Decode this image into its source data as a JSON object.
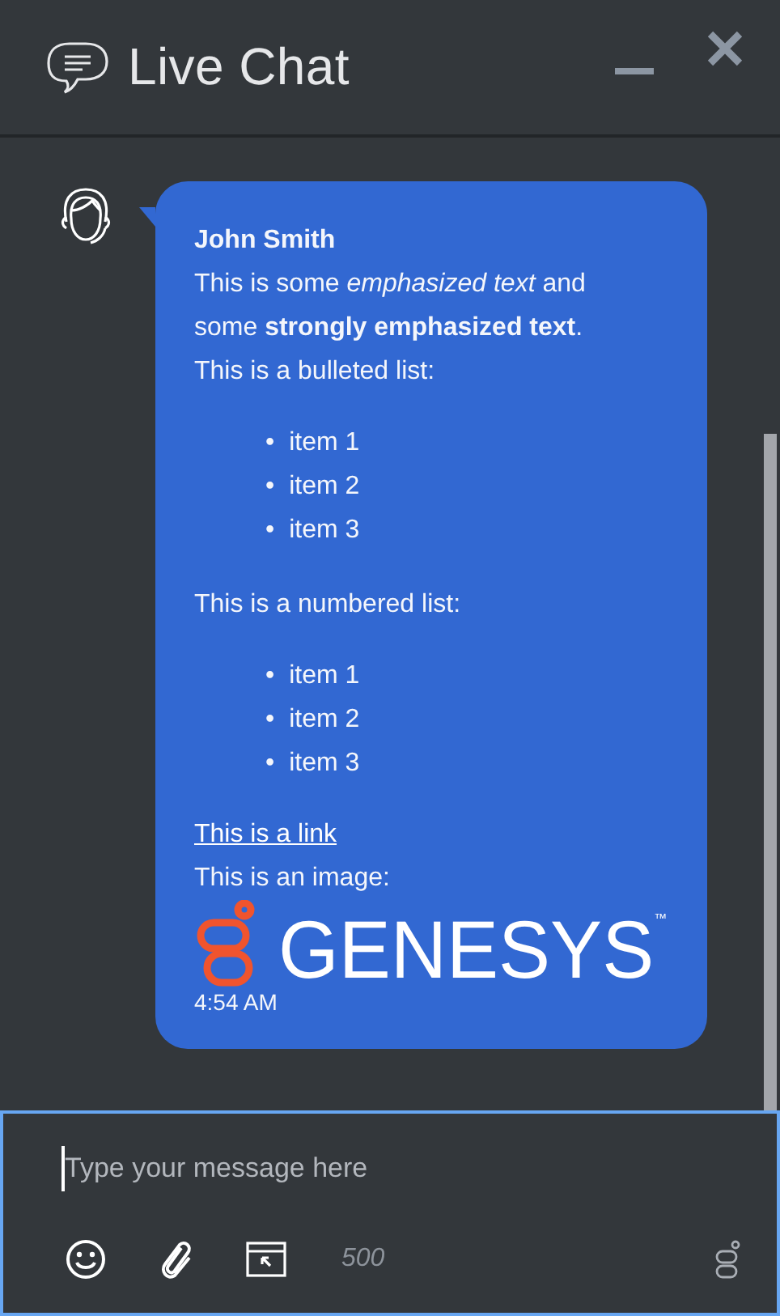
{
  "header": {
    "title": "Live Chat"
  },
  "messages": [
    {
      "sender": "John Smith",
      "time": "4:54 AM",
      "blocks": [
        {
          "kind": "line",
          "text": "This is some *emphasized text* and some **strongly emphasized text**."
        },
        {
          "kind": "line",
          "text": "This is a bulleted list:"
        },
        {
          "kind": "list",
          "marker": "•",
          "items": [
            "item 1",
            "item 2",
            "item 3"
          ]
        },
        {
          "kind": "line",
          "text": "This is a numbered list:"
        },
        {
          "kind": "list",
          "marker": "•",
          "items": [
            "item 1",
            "item 2",
            "item 3"
          ]
        },
        {
          "kind": "link",
          "text": "This is a link"
        },
        {
          "kind": "line",
          "text": "This is an image:"
        },
        {
          "kind": "image",
          "wordmark": "GENESYS",
          "trademark": "™"
        }
      ]
    }
  ],
  "composer": {
    "placeholder": "Type your message here",
    "char_limit": "500"
  }
}
